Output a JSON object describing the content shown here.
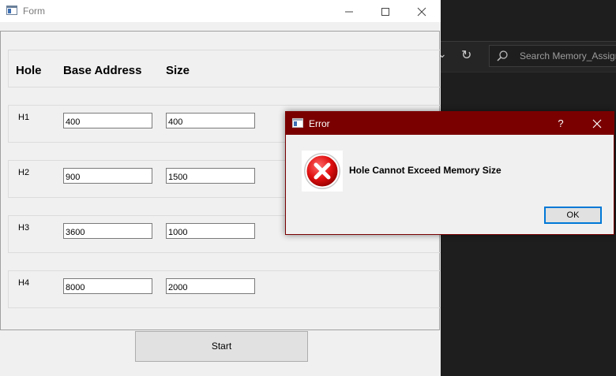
{
  "form": {
    "title": "Form",
    "headers": {
      "hole": "Hole",
      "base_address": "Base Address",
      "size": "Size"
    },
    "rows": [
      {
        "label": "H1",
        "base": "400",
        "size": "400"
      },
      {
        "label": "H2",
        "base": "900",
        "size": "1500"
      },
      {
        "label": "H3",
        "base": "3600",
        "size": "1000"
      },
      {
        "label": "H4",
        "base": "8000",
        "size": "2000"
      }
    ],
    "start_label": "Start"
  },
  "error_dialog": {
    "title": "Error",
    "help": "?",
    "message": "Hole Cannot Exceed Memory Size",
    "ok_label": "OK"
  },
  "background": {
    "search_placeholder": "Search Memory_Assign"
  },
  "colors": {
    "dialog_titlebar": "#7a0000",
    "focus_border": "#0078d7",
    "ide_background": "#1e1e1e"
  }
}
